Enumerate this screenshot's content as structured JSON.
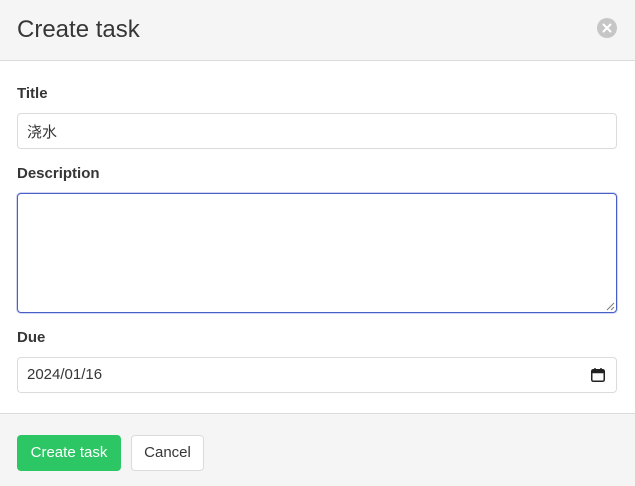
{
  "modal": {
    "title": "Create task",
    "close_icon": "close-icon"
  },
  "form": {
    "title_label": "Title",
    "title_value": "浇水",
    "description_label": "Description",
    "description_value": "",
    "due_label": "Due",
    "due_value": "2024/01/16",
    "due_icon": "calendar-icon"
  },
  "footer": {
    "create_label": "Create task",
    "cancel_label": "Cancel"
  },
  "colors": {
    "primary_button": "#2dc665",
    "focus_border": "#485fc7",
    "header_bg": "#f5f5f5",
    "text": "#363636"
  }
}
